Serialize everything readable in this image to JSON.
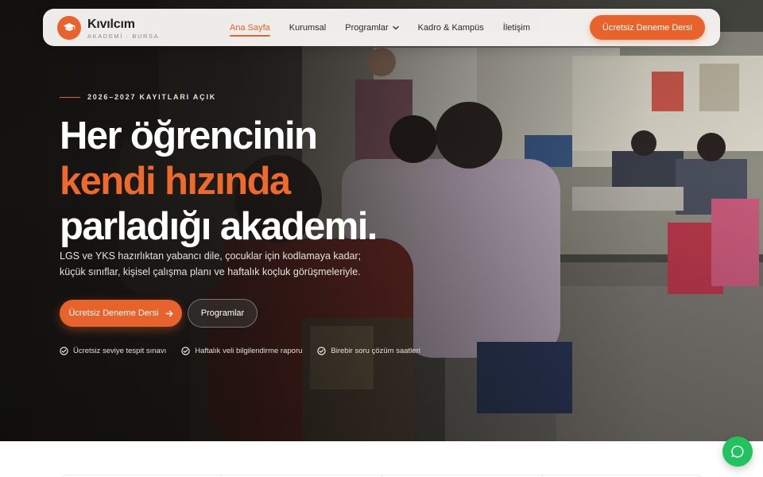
{
  "brand": {
    "name": "Kıvılcım",
    "subtitle": "AKADEMİ · BURSA",
    "logo_icon": "graduation-cap-icon",
    "accent_color": "#e8632b"
  },
  "nav": {
    "items": [
      {
        "label": "Ana Sayfa",
        "active": true
      },
      {
        "label": "Kurumsal",
        "active": false
      },
      {
        "label": "Programlar",
        "active": false,
        "has_dropdown": true
      },
      {
        "label": "Kadro & Kampüs",
        "active": false
      },
      {
        "label": "İletişim",
        "active": false
      }
    ],
    "cta_label": "Ücretsiz Deneme Dersi"
  },
  "hero": {
    "eyebrow": "2026–2027 KAYITLARI AÇIK",
    "headline_line1": "Her öğrencinin",
    "headline_highlight": "kendi hızında",
    "headline_line3": "parladığı akademi.",
    "lead": "LGS ve YKS hazırlıktan yabancı dile, çocuklar için kodlamaya kadar; küçük sınıflar, kişisel çalışma planı ve haftalık koçluk görüşmeleriyle.",
    "primary_button": "Ücretsiz Deneme Dersi",
    "secondary_button": "Programlar",
    "features": [
      "Ücretsiz seviye tespit sınavı",
      "Haftalık veli bilgilendirme raporu",
      "Birebir soru çözüm saatleri"
    ]
  },
  "chat": {
    "icon": "chat-bubble-icon",
    "color": "#22c35e"
  }
}
